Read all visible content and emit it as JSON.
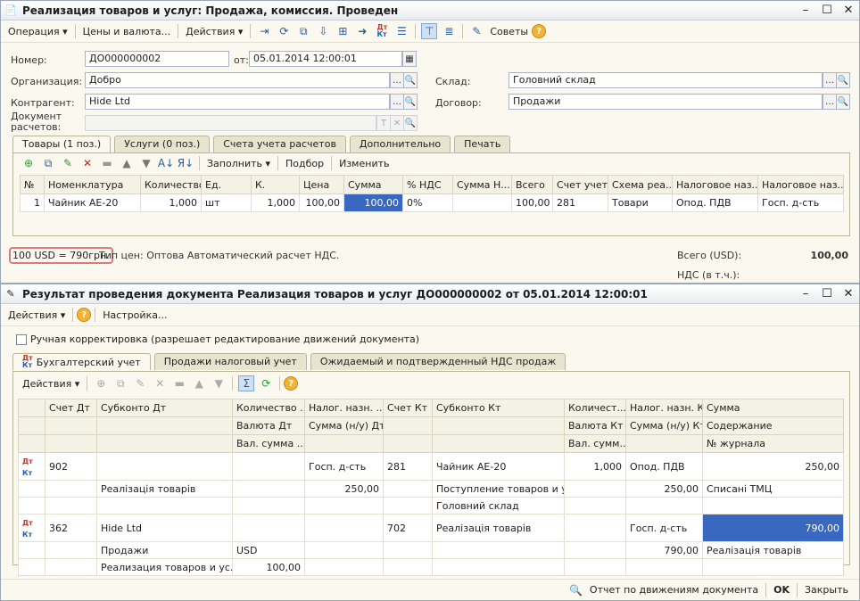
{
  "win1": {
    "title": "Реализация товаров и услуг: Продажа, комиссия. Проведен",
    "toolbar": {
      "operation": "Операция ▾",
      "prices": "Цены и валюта...",
      "actions": "Действия ▾",
      "tips": "Советы"
    },
    "labels": {
      "number": "Номер:",
      "from": "от:",
      "org": "Организация:",
      "counterparty": "Контрагент:",
      "settlement_doc": "Документ расчетов:",
      "warehouse": "Склад:",
      "contract": "Договор:"
    },
    "values": {
      "number": "ДО000000002",
      "date": "05.01.2014 12:00:01",
      "org": "Добро",
      "counterparty": "Hide Ltd",
      "settlement_doc": "",
      "warehouse": "Головний склад",
      "contract": "Продажи"
    },
    "tabs": [
      "Товары (1 поз.)",
      "Услуги (0 поз.)",
      "Счета учета расчетов",
      "Дополнительно",
      "Печать"
    ],
    "grid_toolbar": {
      "fill": "Заполнить ▾",
      "pick": "Подбор",
      "change": "Изменить"
    },
    "columns": [
      "№",
      "Номенклатура",
      "Количество",
      "Ед.",
      "К.",
      "Цена",
      "Сумма",
      "% НДС",
      "Сумма Н...",
      "Всего",
      "Счет учета",
      "Схема реа...",
      "Налоговое наз...",
      "Налоговое наз..."
    ],
    "rows": [
      [
        "1",
        "Чайник АЕ-20",
        "1,000",
        "шт",
        "1,000",
        "100,00",
        "100,00",
        "0%",
        "",
        "100,00",
        "281",
        "Товари",
        "Опод. ПДВ",
        "Госп. д-сть"
      ]
    ],
    "footer": {
      "rate": "100 USD = 790грн.",
      "price_type": "Тип цен: Оптова Автоматический расчет НДС.",
      "total_label": "Всего (USD):",
      "total_value": "100,00",
      "vat_label": "НДС (в т.ч.):"
    }
  },
  "win2": {
    "title": "Результат проведения документа Реализация товаров и услуг ДО000000002 от 05.01.2014 12:00:01",
    "toolbar": {
      "actions": "Действия ▾",
      "settings": "Настройка..."
    },
    "manual_check": "Ручная корректировка (разрешает редактирование движений документа)",
    "tabs": [
      "Бухгалтерский учет",
      "Продажи налоговый учет",
      "Ожидаемый и подтвержденный НДС продаж"
    ],
    "grid_actions": "Действия ▾",
    "header_rows": [
      [
        "",
        "Счет Дт",
        "Субконто Дт",
        "Количество ...",
        "Налог. назн. ...",
        "Счет Кт",
        "Субконто Кт",
        "Количест...",
        "Налог. назн. Кт",
        "Сумма"
      ],
      [
        "",
        "",
        "",
        "Валюта Дт",
        "Сумма (н/у) Дт",
        "",
        "",
        "Валюта Кт",
        "Сумма (н/у) Кт",
        "Содержание"
      ],
      [
        "",
        "",
        "",
        "Вал. сумма ...",
        "",
        "",
        "",
        "Вал. сумм...",
        "",
        "№ журнала"
      ]
    ],
    "entries": [
      [
        [
          "",
          "902",
          "",
          "",
          "Госп. д-сть",
          "281",
          "Чайник АЕ-20",
          "1,000",
          "Опод. ПДВ",
          "250,00"
        ],
        [
          "",
          "",
          "Реалізація товарів",
          "",
          "250,00",
          "",
          "Поступление товаров и у...",
          "",
          "250,00",
          "Списані ТМЦ"
        ],
        [
          "",
          "",
          "",
          "",
          "",
          "",
          "Головний склад",
          "",
          "",
          ""
        ]
      ],
      [
        [
          "",
          "362",
          "Hide Ltd",
          "",
          "",
          "702",
          "Реалізація товарів",
          "",
          "Госп. д-сть",
          "790,00"
        ],
        [
          "",
          "",
          "Продажи",
          "USD",
          "",
          "",
          "",
          "",
          "790,00",
          "Реалізація товарів"
        ],
        [
          "",
          "",
          "Реализация товаров и ус...",
          "100,00",
          "",
          "",
          "",
          "",
          "",
          ""
        ]
      ]
    ],
    "bottom": {
      "report": "Отчет по движениям документа",
      "ok": "OK",
      "close": "Закрыть"
    }
  }
}
